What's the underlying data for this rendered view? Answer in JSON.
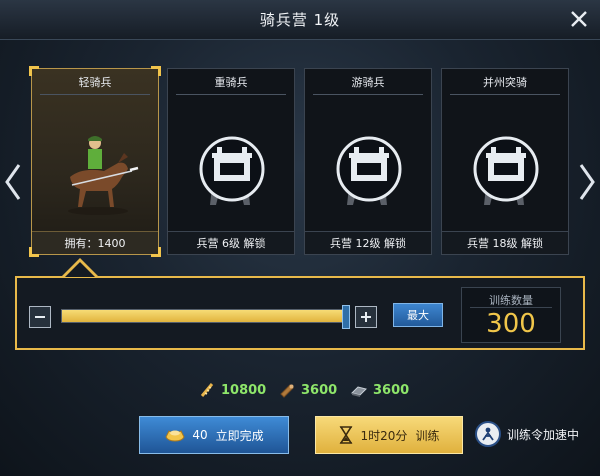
{
  "window": {
    "title": "骑兵营 1级"
  },
  "units": [
    {
      "name": "轻骑兵",
      "footer": "拥有：1400",
      "selected": true,
      "locked": false
    },
    {
      "name": "重骑兵",
      "footer": "兵营 6级 解锁",
      "selected": false,
      "locked": true
    },
    {
      "name": "游骑兵",
      "footer": "兵营 12级 解锁",
      "selected": false,
      "locked": true
    },
    {
      "name": "并州突骑",
      "footer": "兵营 18级 解锁",
      "selected": false,
      "locked": true
    }
  ],
  "training": {
    "max_label": "最大",
    "count_label": "训练数量",
    "count_value": "300",
    "slider_level": 1.0
  },
  "costs": [
    {
      "icon": "grain-icon",
      "value": "10800"
    },
    {
      "icon": "wood-icon",
      "value": "3600"
    },
    {
      "icon": "iron-icon",
      "value": "3600"
    }
  ],
  "actions": {
    "instant_cost": "40",
    "instant_label": "立即完成",
    "train_time": "1时20分",
    "train_label": "训练",
    "speedup_label": "训练令加速中"
  },
  "colors": {
    "accent_gold": "#e8b94a",
    "button_blue": "#2f6fb3",
    "cost_green": "#8ee66a"
  }
}
